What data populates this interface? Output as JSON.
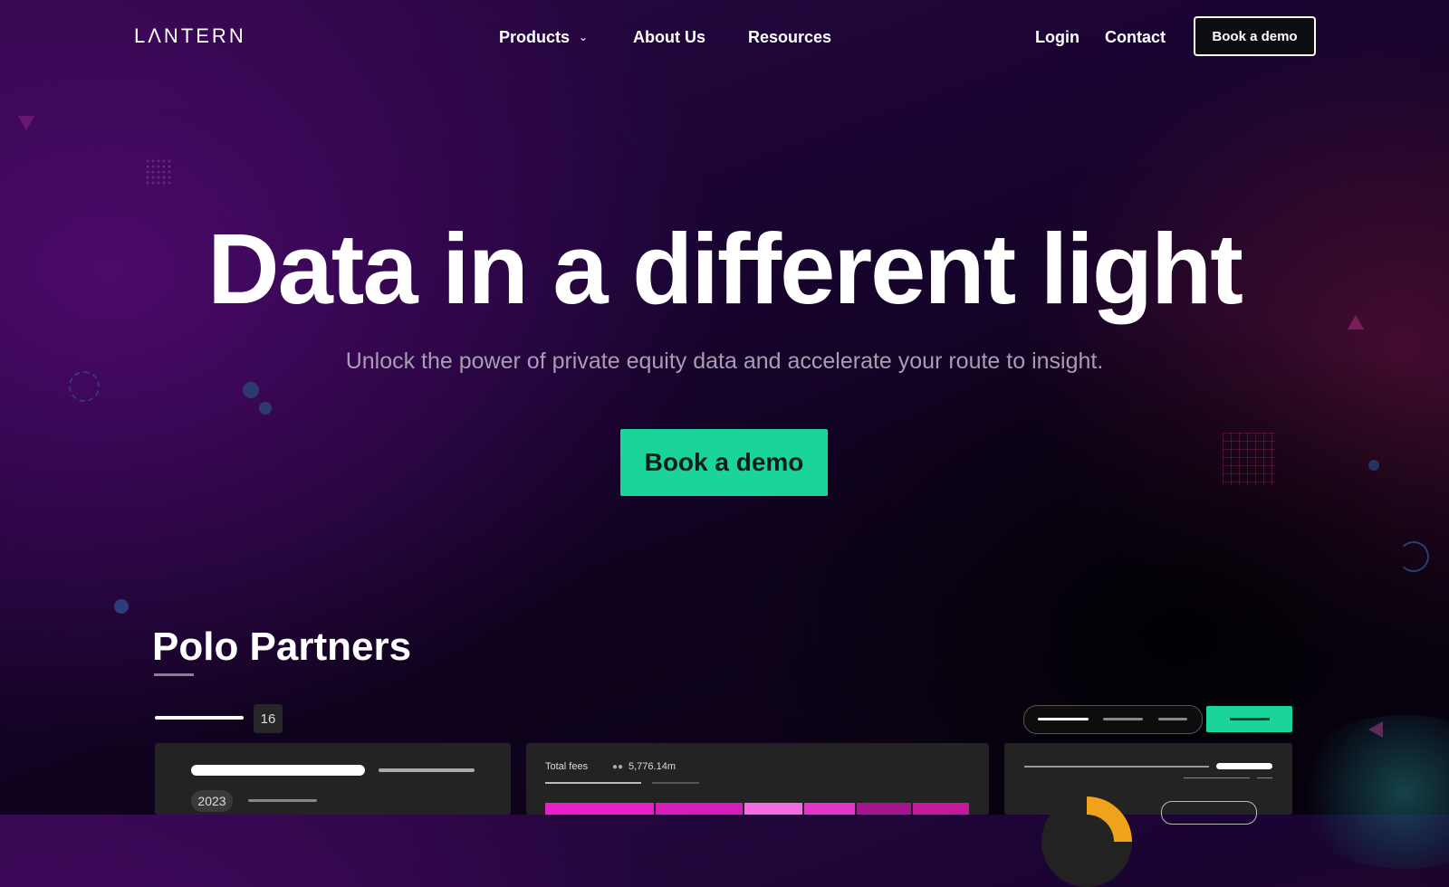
{
  "nav": {
    "logo": "LΛNTERN",
    "links": [
      {
        "label": "Products",
        "has_dropdown": true
      },
      {
        "label": "About Us"
      },
      {
        "label": "Resources"
      }
    ],
    "login": "Login",
    "contact": "Contact",
    "cta": "Book a demo"
  },
  "hero": {
    "title": "Data in a different light",
    "subtitle": "Unlock the power of private equity data and accelerate your route to insight.",
    "cta": "Book a demo"
  },
  "preview": {
    "company": "Polo Partners",
    "count": "16",
    "year": "2023",
    "fees_label": "Total fees",
    "fees_value": "5,776.14m",
    "fees_icon": "coins-icon"
  },
  "colors": {
    "accent": "#1ad49a",
    "magenta": "#e81fc8",
    "orange": "#f0a21a"
  }
}
